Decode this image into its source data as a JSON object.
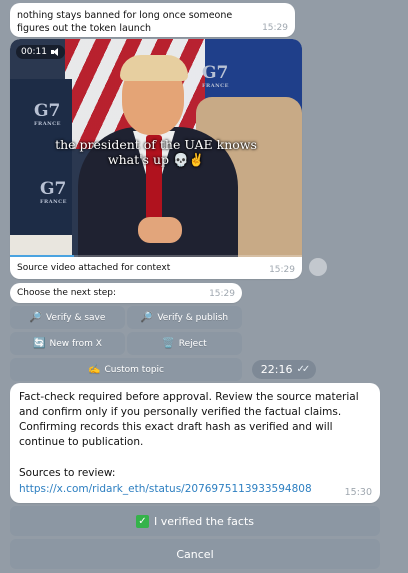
{
  "messages": {
    "msg1": {
      "text": "nothing stays banned for long once someone figures out the token launch",
      "time": "15:29"
    },
    "video": {
      "duration": "00:11",
      "caption_overlay_line1": "the president of the UAE knows",
      "caption_overlay_line2": "what's up 💀✌️",
      "g7_label": "G7",
      "g7_sub": "FRANCE",
      "description": "Source video attached for context",
      "time": "15:29",
      "progress": 0.22
    },
    "next_step": {
      "text": "Choose the next step:",
      "time": "15:29"
    },
    "fact_check": {
      "text": "Fact-check required before approval. Review the source material and confirm only if you personally verified the factual claims. Confirming records this exact draft hash as verified and will continue to publication.",
      "sources_label": "Sources to review:",
      "source_link": "https://x.com/ridark_eth/status/2076975113933594808",
      "time": "15:30"
    }
  },
  "keyboard": {
    "verify_save": {
      "icon": "🔎",
      "label": "Verify & save"
    },
    "verify_publish": {
      "icon": "🔎",
      "label": "Verify & publish"
    },
    "new_from_x": {
      "icon": "🔄",
      "label": "New from X"
    },
    "reject": {
      "icon": "🗑️",
      "label": "Reject"
    },
    "custom_topic": {
      "icon": "✍️",
      "label": "Custom topic"
    }
  },
  "outgoing_time": "22:16",
  "buttons": {
    "verified": {
      "icon": "✓",
      "label": "I verified the facts"
    },
    "cancel": {
      "label": "Cancel"
    }
  },
  "colors": {
    "wallpaper": "#939ca6",
    "button": "#8c97a3",
    "link": "#2d7fc1",
    "check": "#34b34a"
  }
}
